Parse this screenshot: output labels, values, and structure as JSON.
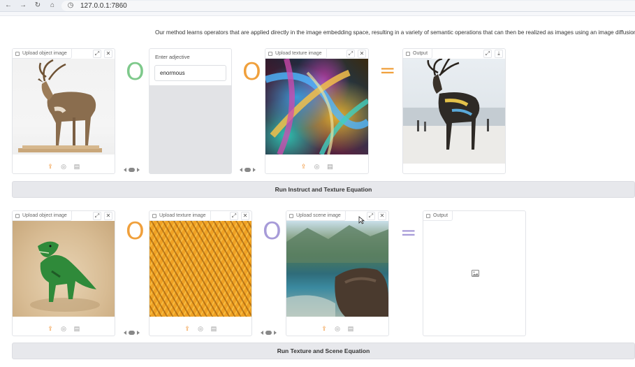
{
  "browser": {
    "url": "127.0.0.1:7860"
  },
  "description": "Our method learns operators that are applied directly in the image embedding space, resulting in a variety of semantic operations that can then be realized as images using an image diffusion model.",
  "colors": {
    "green": "#7ec98b",
    "orange": "#f0a03c",
    "purple": "#a79bd8",
    "upload": "#f08a24"
  },
  "row1": {
    "object_label": "Upload object image",
    "adjective_label": "Enter adjective",
    "adjective_value": "enormous",
    "texture_label": "Upload texture image",
    "output_label": "Output",
    "op1": "O",
    "op2": "O",
    "equals": "=",
    "run_button": "Run Instruct and Texture Equation"
  },
  "row2": {
    "object_label": "Upload object image",
    "texture_label": "Upload texture image",
    "scene_label": "Upload scene image",
    "output_label": "Output",
    "op1": "O",
    "op2": "O",
    "equals": "=",
    "run_button": "Run Texture and Scene Equation"
  },
  "icons": {
    "expand": "expand-icon",
    "close": "close-icon",
    "download": "download-icon",
    "upload": "upload-icon",
    "webcam": "webcam-icon",
    "clipboard": "clipboard-icon",
    "image_placeholder": "image-placeholder-icon"
  }
}
